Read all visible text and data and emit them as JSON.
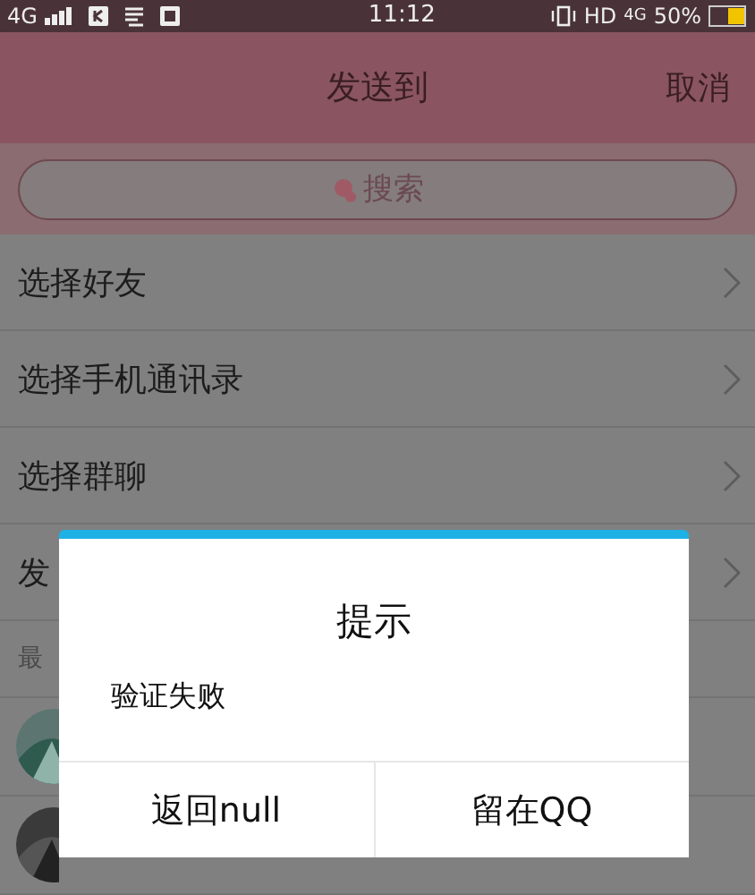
{
  "status_bar": {
    "network": "4G",
    "time": "11:12",
    "hd": "HD",
    "network_right": "4G",
    "battery": "50%"
  },
  "header": {
    "title": "发送到",
    "cancel": "取消"
  },
  "search": {
    "placeholder": "搜索"
  },
  "list": [
    {
      "label": "选择好友"
    },
    {
      "label": "选择手机通讯录"
    },
    {
      "label": "选择群聊"
    },
    {
      "label": "发"
    }
  ],
  "section": {
    "label": "最"
  },
  "dialog": {
    "title": "提示",
    "message": "验证失败",
    "buttons": [
      "返回null",
      "留在QQ"
    ]
  }
}
